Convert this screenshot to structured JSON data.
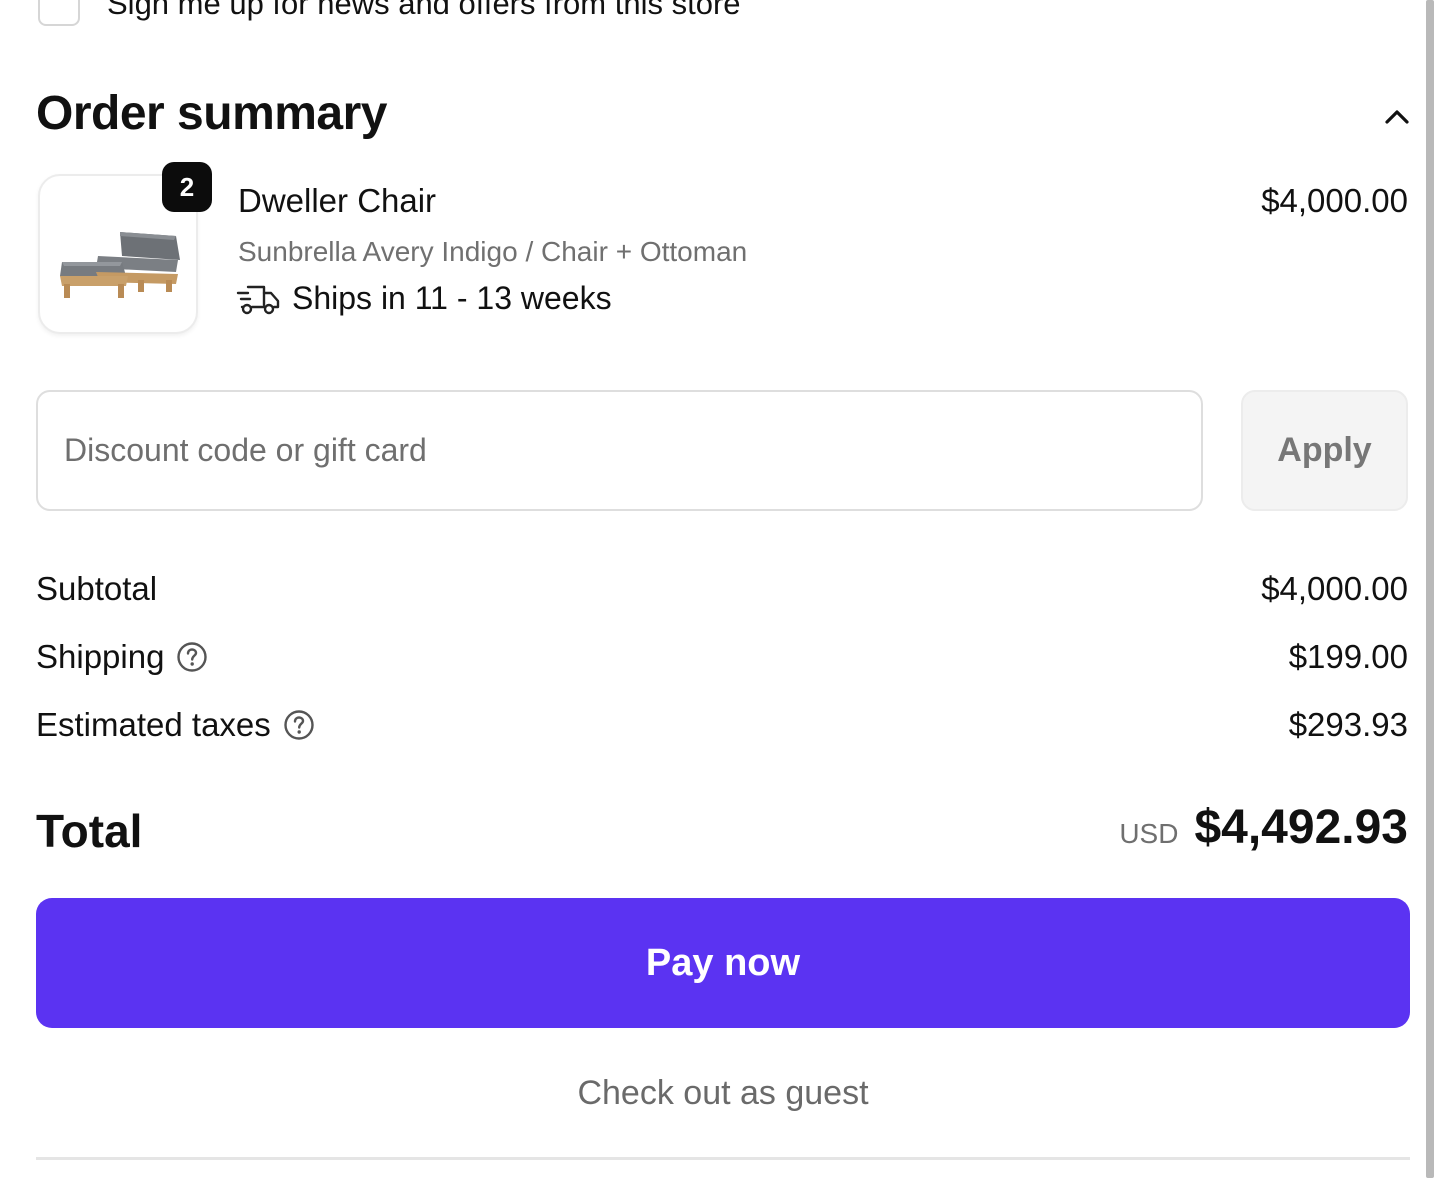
{
  "newsletter": {
    "label": "Sign me up for news and offers from this store"
  },
  "summary": {
    "title": "Order summary",
    "toggle_icon": "chevron-up-icon"
  },
  "product": {
    "quantity": "2",
    "name": "Dweller Chair",
    "variant": "Sunbrella Avery Indigo / Chair + Ottoman",
    "shipping_note": "Ships in 11 - 13 weeks",
    "shipping_icon": "delivery-truck-icon",
    "price": "$4,000.00"
  },
  "discount": {
    "placeholder": "Discount code or gift card",
    "apply_label": "Apply"
  },
  "lines": {
    "subtotal_label": "Subtotal",
    "subtotal_value": "$4,000.00",
    "shipping_label": "Shipping",
    "shipping_value": "$199.00",
    "taxes_label": "Estimated taxes",
    "taxes_value": "$293.93"
  },
  "total": {
    "label": "Total",
    "currency": "USD",
    "amount": "$4,492.93"
  },
  "actions": {
    "pay_label": "Pay now",
    "guest_label": "Check out as guest"
  },
  "colors": {
    "accent": "#5b33f2",
    "badge": "#0c0c0c",
    "muted_text": "#707070"
  }
}
